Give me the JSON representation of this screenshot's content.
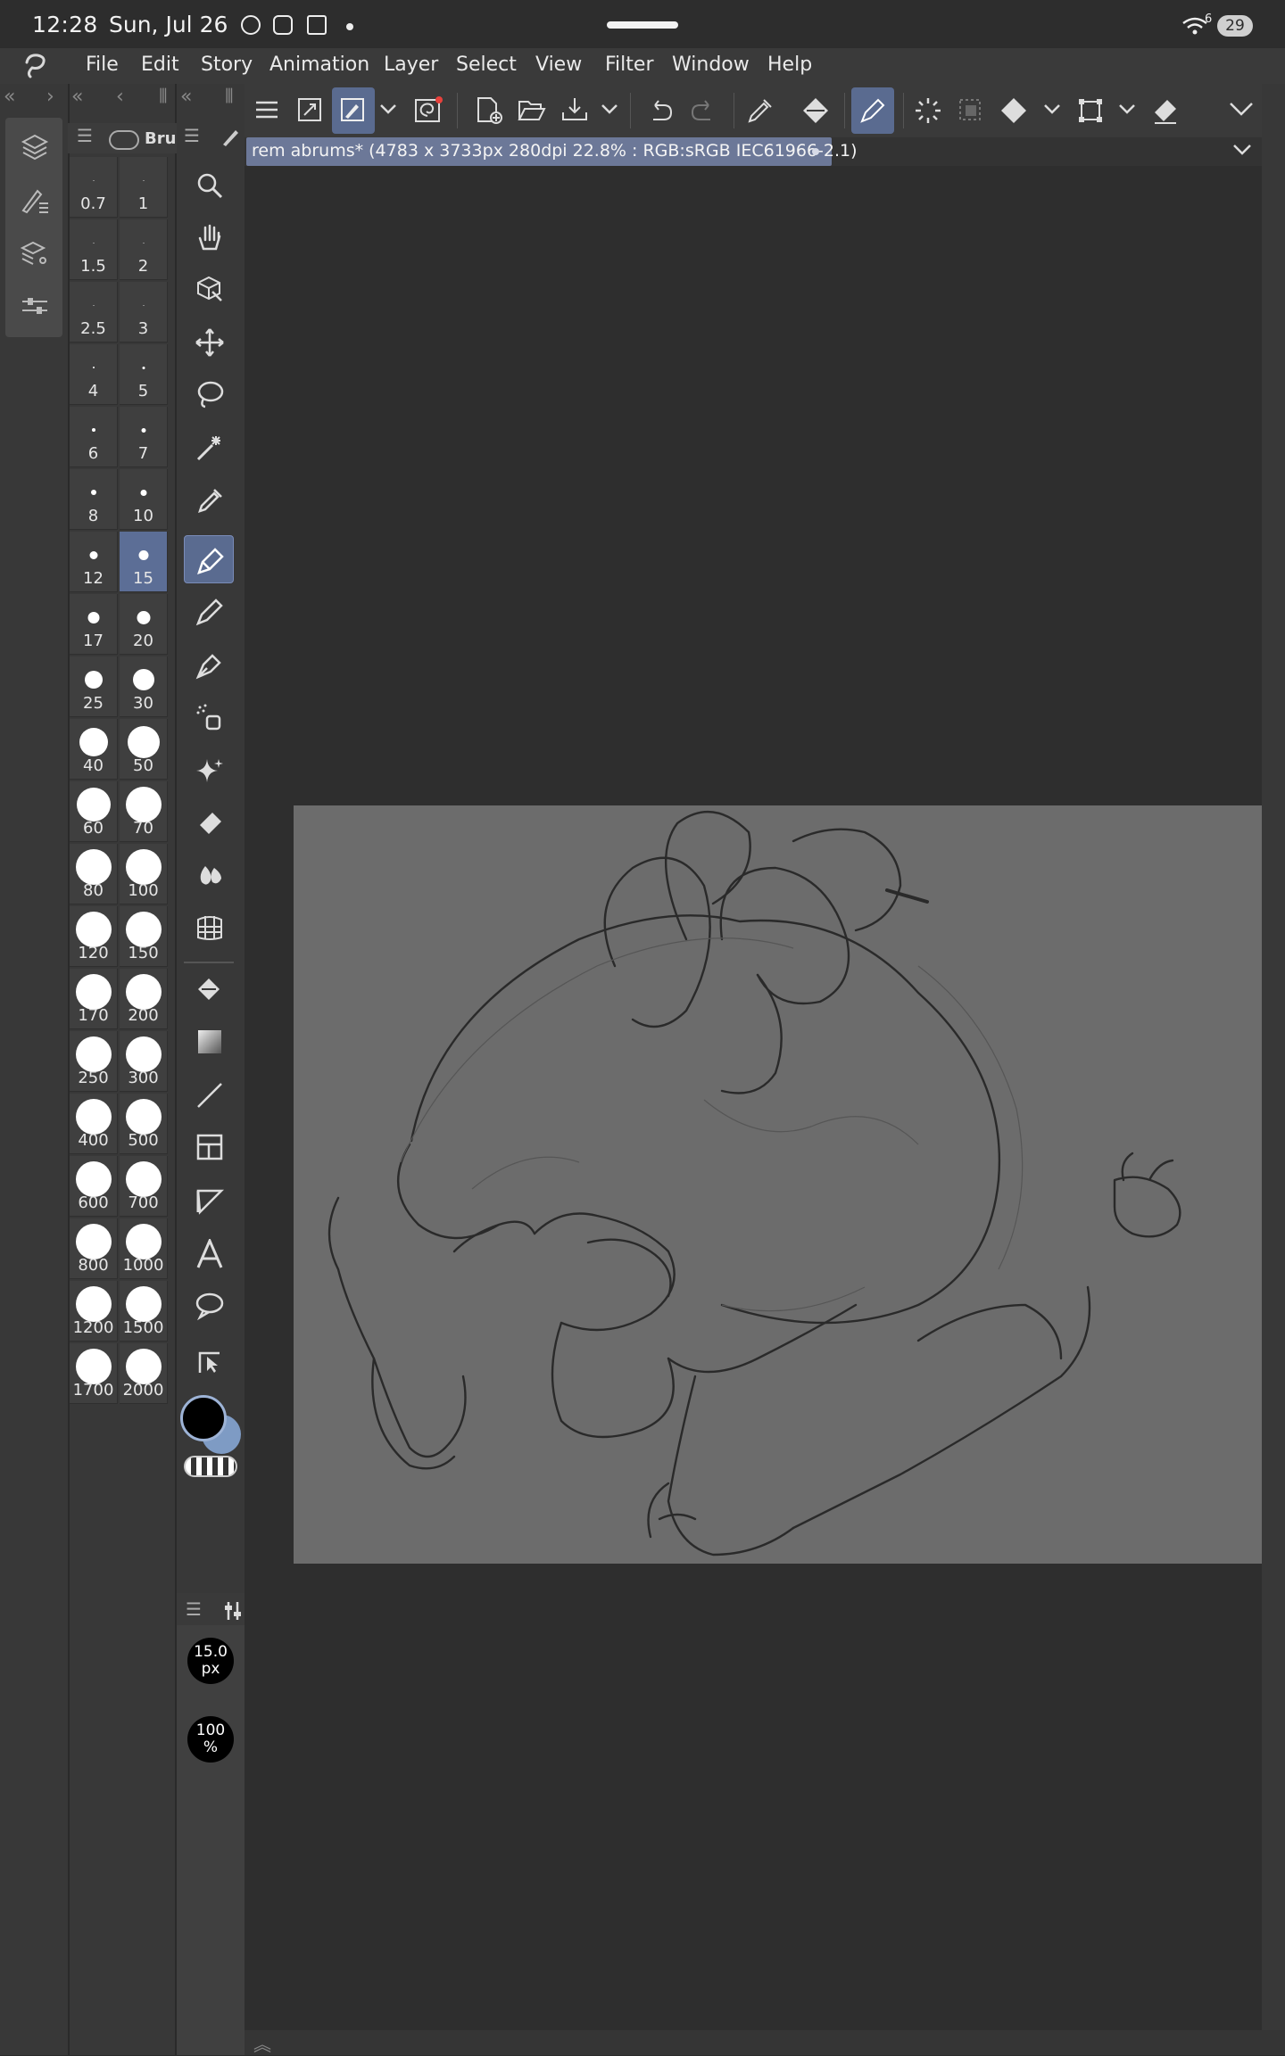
{
  "status_bar": {
    "time": "12:28",
    "date": "Sun, Jul 26",
    "signal_badge": "6",
    "battery": "29"
  },
  "menu": {
    "items": [
      "File",
      "Edit",
      "Story",
      "Animation",
      "Layer",
      "Select",
      "View",
      "Filter",
      "Window",
      "Help"
    ]
  },
  "brush_panel": {
    "tab_label": "Bru",
    "sizes": [
      "0.7",
      "1",
      "1.5",
      "2",
      "2.5",
      "3",
      "4",
      "5",
      "6",
      "7",
      "8",
      "10",
      "12",
      "15",
      "17",
      "20",
      "25",
      "30",
      "40",
      "50",
      "60",
      "70",
      "80",
      "100",
      "120",
      "150",
      "170",
      "200",
      "250",
      "300",
      "400",
      "500",
      "600",
      "700",
      "800",
      "1000",
      "1200",
      "1500",
      "1700",
      "2000"
    ],
    "selected": "15"
  },
  "tools": [
    "zoom",
    "hand",
    "object",
    "move",
    "lasso",
    "magic-wand",
    "eyedropper",
    "pen",
    "pencil",
    "brush",
    "airbrush",
    "decoration",
    "eraser",
    "blend",
    "grid",
    "fill",
    "gradient",
    "line",
    "frame",
    "ruler",
    "text",
    "balloon",
    "correct-line"
  ],
  "sub_tool": {
    "size_value": "15.0",
    "size_unit": "px",
    "opacity_value": "100",
    "opacity_unit": "%"
  },
  "document": {
    "tab_title": "rem abrums* (4783 x 3733px 280dpi 22.8% : RGB:sRGB IEC61966-2.1)"
  },
  "colors": {
    "accent": "#5a6b90",
    "main_color": "#000000",
    "sub_color": "#7e9bc4"
  }
}
